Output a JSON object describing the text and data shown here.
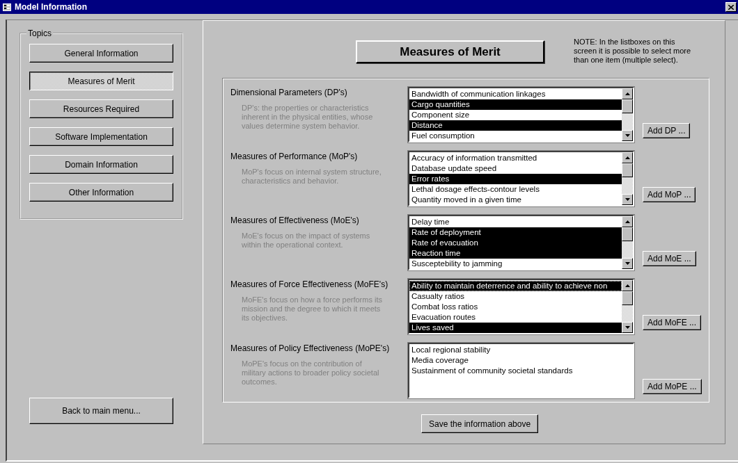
{
  "window": {
    "title": "Model Information"
  },
  "topics": {
    "title": "Topics",
    "items": [
      {
        "label": "General Information",
        "selected": false
      },
      {
        "label": "Measures of Merit",
        "selected": true
      },
      {
        "label": "Resources Required",
        "selected": false
      },
      {
        "label": "Software Implementation",
        "selected": false
      },
      {
        "label": "Domain Information",
        "selected": false
      },
      {
        "label": "Other Information",
        "selected": false
      }
    ]
  },
  "back_button": "Back to main menu...",
  "heading": "Measures of Merit",
  "note": "NOTE: In the listboxes on this screen it is possible to select more than one item (multiple select).",
  "sections": [
    {
      "kind": "scrolling",
      "label": "Dimensional Parameters (DP's)",
      "description": "DP's: the properties or characteristics inherent in the physical entities, whose values determine system behavior.",
      "add_button": "Add DP ...",
      "items": [
        {
          "text": "Bandwidth of communication linkages",
          "selected": false
        },
        {
          "text": "Cargo quantities",
          "selected": true
        },
        {
          "text": "Component size",
          "selected": false
        },
        {
          "text": "Distance",
          "selected": true
        },
        {
          "text": "Fuel consumption",
          "selected": false
        }
      ]
    },
    {
      "kind": "scrolling",
      "label": "Measures of Performance (MoP's)",
      "description": "MoP's focus on internal system structure, characteristics and behavior.",
      "add_button": "Add MoP ...",
      "items": [
        {
          "text": "Accuracy of information transmitted",
          "selected": false
        },
        {
          "text": "Database update speed",
          "selected": false
        },
        {
          "text": "Error rates",
          "selected": true
        },
        {
          "text": "Lethal dosage effects-contour levels",
          "selected": false
        },
        {
          "text": "Quantity moved in a given time",
          "selected": false
        }
      ]
    },
    {
      "kind": "scrolling",
      "label": "Measures of Effectiveness (MoE's)",
      "description": "MoE's focus on the impact of systems within the operational context.",
      "add_button": "Add MoE ...",
      "items": [
        {
          "text": "Delay time",
          "selected": false
        },
        {
          "text": "Rate of deployment",
          "selected": true
        },
        {
          "text": "Rate of evacuation",
          "selected": true
        },
        {
          "text": "Reaction time",
          "selected": true
        },
        {
          "text": "Susceptebility to jamming",
          "selected": false
        }
      ]
    },
    {
      "kind": "scrolling",
      "label": "Measures of Force Effectiveness (MoFE's)",
      "description": "MoFE's focus on how a force performs its mission and the degree to which it meets its objectives.",
      "add_button": "Add MoFE ...",
      "items": [
        {
          "text": "Ability to maintain deterrence and ability to achieve non",
          "selected": true,
          "focused": true
        },
        {
          "text": "Casualty ratios",
          "selected": false,
          "focused": false
        },
        {
          "text": "Combat loss ratios",
          "selected": false,
          "focused": false
        },
        {
          "text": "Evacuation routes",
          "selected": false,
          "focused": false
        },
        {
          "text": "Lives saved",
          "selected": true,
          "focused": false
        }
      ]
    },
    {
      "kind": "plain",
      "label": "Measures of Policy Effectiveness (MoPE's)",
      "description": "MoPE's focus on the contribution of military actions to broader policy societal outcomes.",
      "add_button": "Add MoPE ...",
      "items": [
        {
          "text": "Local regional stability",
          "selected": false
        },
        {
          "text": "Media coverage",
          "selected": false
        },
        {
          "text": "Sustainment of community societal standards",
          "selected": false
        }
      ]
    }
  ],
  "save_button": "Save the information above"
}
